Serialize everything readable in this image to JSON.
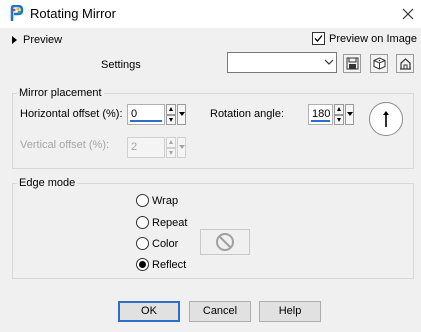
{
  "window": {
    "title": "Rotating Mirror",
    "close_label": "✕"
  },
  "preview": {
    "toggle_label": "Preview",
    "checkbox_label": "Preview on Image",
    "checkbox_checked": true
  },
  "settings": {
    "label": "Settings",
    "combo_value": ""
  },
  "toolbar": {
    "icons": [
      "save-preset-icon",
      "randomize-icon",
      "reset-icon"
    ]
  },
  "mirror_placement": {
    "legend": "Mirror placement",
    "horizontal_offset": {
      "label": "Horizontal offset (%):",
      "value": "0"
    },
    "vertical_offset": {
      "label": "Vertical offset (%):",
      "value": "2",
      "disabled": true
    },
    "rotation_angle": {
      "label": "Rotation angle:",
      "value": "180"
    }
  },
  "edge_mode": {
    "legend": "Edge mode",
    "options": [
      {
        "label": "Wrap",
        "selected": false
      },
      {
        "label": "Repeat",
        "selected": false
      },
      {
        "label": "Color",
        "selected": false
      },
      {
        "label": "Reflect",
        "selected": true
      }
    ]
  },
  "buttons": {
    "ok": "OK",
    "cancel": "Cancel",
    "help": "Help"
  },
  "colors": {
    "accent": "#2b6fc7",
    "background": "#f0f0f0"
  }
}
